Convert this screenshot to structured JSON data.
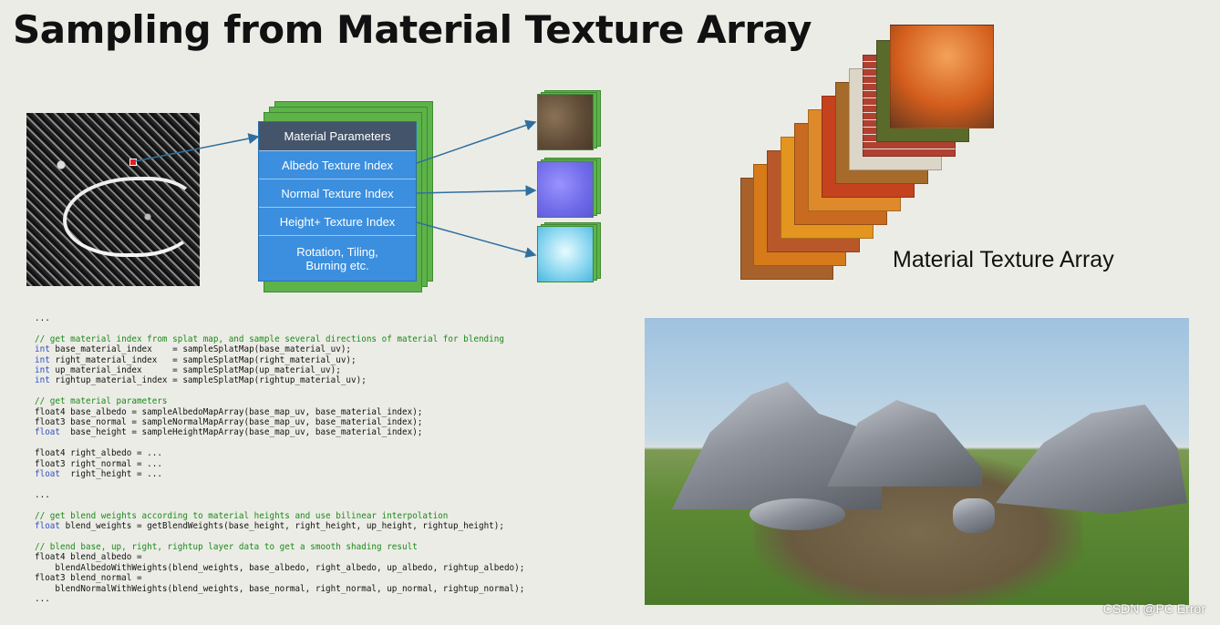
{
  "slide": {
    "title": "Sampling from Material Texture Array",
    "array_label": "Material Texture Array",
    "watermark": "CSDN @PC Error"
  },
  "params": {
    "header": "Material Parameters",
    "rows": [
      "Albedo Texture Index",
      "Normal Texture Index",
      "Height+ Texture Index",
      "Rotation, Tiling,",
      "Burning etc."
    ]
  },
  "colors": {
    "box_blue": "#3b8fde",
    "header_gray": "#44546a",
    "stack_green": "#5db34a",
    "arrow": "#2f6f9f"
  },
  "code": {
    "l01": "...",
    "l02": "// get material index from splat map, and sample several directions of material for blending",
    "l03k": "int",
    "l03": " base_material_index    = sampleSplatMap(base_material_uv);",
    "l04k": "int",
    "l04": " right_material_index   = sampleSplatMap(right_material_uv);",
    "l05k": "int",
    "l05": " up_material_index      = sampleSplatMap(up_material_uv);",
    "l06k": "int",
    "l06": " rightup_material_index = sampleSplatMap(rightup_material_uv);",
    "l07": "// get material parameters",
    "l08": "float4 base_albedo = sampleAlbedoMapArray(base_map_uv, base_material_index);",
    "l09": "float3 base_normal = sampleNormalMapArray(base_map_uv, base_material_index);",
    "l10k": "float",
    "l10": "  base_height = sampleHeightMapArray(base_map_uv, base_material_index);",
    "l11": "float4 right_albedo = ...",
    "l12": "float3 right_normal = ...",
    "l13k": "float",
    "l13": "  right_height = ...",
    "l14": "...",
    "l15": "// get blend weights according to material heights and use bilinear interpolation",
    "l16k": "float",
    "l16": " blend_weights = getBlendWeights(base_height, right_height, up_height, rightup_height);",
    "l17": "// blend base, up, right, rightup layer data to get a smooth shading result",
    "l18": "float4 blend_albedo =",
    "l19": "    blendAlbedoWithWeights(blend_weights, base_albedo, right_albedo, up_albedo, rightup_albedo);",
    "l20": "float3 blend_normal =",
    "l21": "    blendNormalWithWeights(blend_weights, base_normal, right_normal, up_normal, rightup_normal);",
    "l22": "..."
  }
}
